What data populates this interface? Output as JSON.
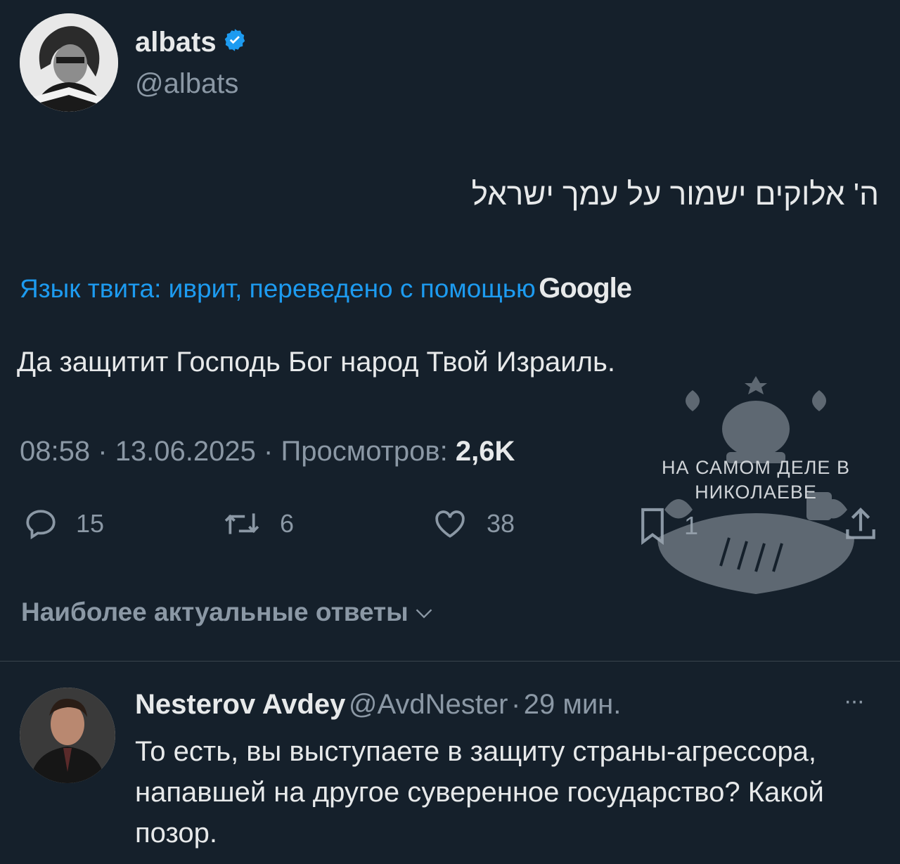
{
  "tweet": {
    "author_name": "albats",
    "author_handle": "@albats",
    "text_hebrew": "ה' אלוקים ישמור על עמך ישראל",
    "translation_label": "Язык твита: иврит, переведено с помощью",
    "translation_provider": "Google",
    "translated_text": "Да защитит Господь Бог народ Твой Израиль.",
    "time": "08:58",
    "date": "13.06.2025",
    "views_label": "Просмотров:",
    "views_count": "2,6K",
    "separator": "·"
  },
  "actions": {
    "replies": "15",
    "retweets": "6",
    "likes": "38",
    "bookmarks": "1"
  },
  "replies_sort_label": "Наиболее актуальные ответы",
  "reply": {
    "author_name": "Nesterov Avdey",
    "author_handle": "@AvdNester",
    "time_ago": "29 мин.",
    "separator": "·",
    "more": "···",
    "text": "То есть, вы выступаете в защиту страны-агрессора, напавшей на другое суверенное государство? Какой позор."
  },
  "watermark": {
    "line1": "НА САМОМ ДЕЛЕ В",
    "line2": "НИКОЛАЕВЕ"
  },
  "colors": {
    "background": "#15202b",
    "accent": "#1d9bf0",
    "muted": "#8b98a5",
    "text": "#e7e9ea"
  }
}
